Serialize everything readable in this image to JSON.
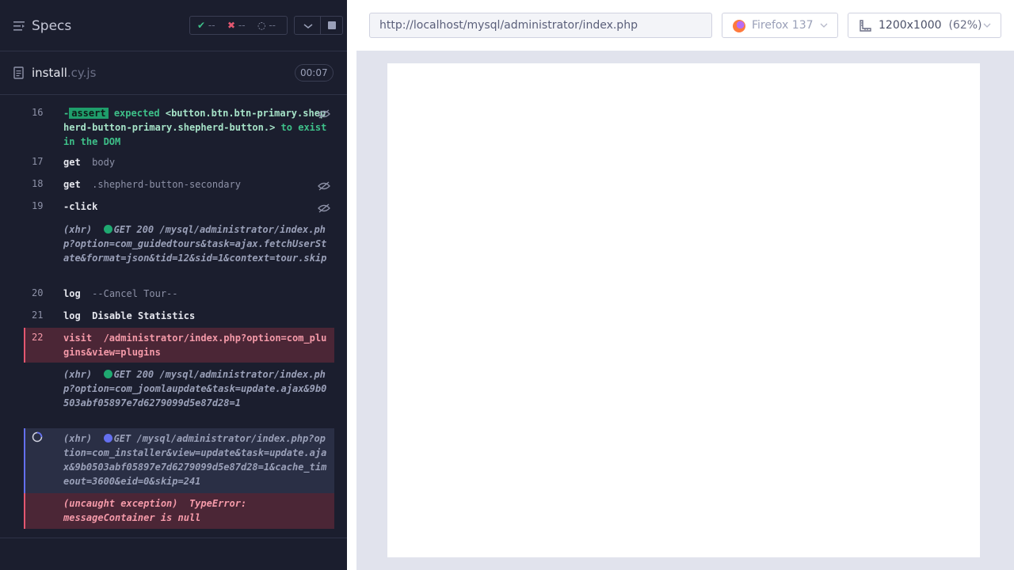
{
  "reporter": {
    "title": "Specs",
    "stats": {
      "passed": "--",
      "failed": "--",
      "pending": "--",
      "passed_sym": "✔",
      "failed_sym": "✖",
      "pending_sym": "◌"
    },
    "file": {
      "name": "install",
      "ext": ".cy.js",
      "duration": "00:07"
    },
    "commands": [
      {
        "num": "16",
        "type": "assert",
        "prefix": "-",
        "badge": "assert",
        "expected": "expected",
        "element": "<button.btn.btn-primary.shepherd-button-primary.shepherd-button.>",
        "suffix": "to exist in the DOM"
      },
      {
        "num": "17",
        "type": "cmd",
        "name": "get",
        "arg": "body"
      },
      {
        "num": "18",
        "type": "cmd",
        "name": "get",
        "arg": ".shepherd-button-secondary"
      },
      {
        "num": "19",
        "type": "cmd",
        "name": "-click",
        "arg": ""
      },
      {
        "type": "xhr",
        "label": "(xhr)",
        "text": "GET 200 /mysql/administrator/index.php?option=com_guidedtours&task=ajax.fetchUserState&format=json&tid=12&sid=1&context=tour.skip"
      },
      {
        "num": "20",
        "type": "cmd",
        "name": "log",
        "arg": "--Cancel Tour--"
      },
      {
        "num": "21",
        "type": "cmd",
        "name": "log",
        "arg": "Disable Statistics"
      },
      {
        "num": "22",
        "type": "failed",
        "name": "visit",
        "arg": "/administrator/index.php?option=com_plugins&view=plugins"
      },
      {
        "type": "xhr",
        "label": "(xhr)",
        "text": "GET 200 /mysql/administrator/index.php?option=com_joomlaupdate&task=update.ajax&9b0503abf05897e7d6279099d5e87d28=1"
      },
      {
        "type": "pending",
        "label": "(xhr)",
        "text": "GET /mysql/administrator/index.php?option=com_installer&view=update&task=update.ajax&9b0503abf05897e7d6279099d5e87d28=1&cache_timeout=3600&eid=0&skip=241"
      },
      {
        "type": "error",
        "label": "(uncaught exception)",
        "text": "TypeError: messageContainer is null"
      }
    ]
  },
  "aut": {
    "url": "http://localhost/mysql/administrator/index.php",
    "browser": "Firefox 137",
    "viewport": "1200x1000",
    "viewport_pct": "(62%)"
  },
  "icons": {
    "specs": "list-icon",
    "file": "document-icon",
    "hide": "eye-slash-icon",
    "expand": "chevron-down-icon",
    "stop": "stop-icon",
    "browser": "firefox-icon",
    "viewport": "ruler-icon"
  },
  "colors": {
    "passed": "#3ec089",
    "failed": "#e45770",
    "pending": "#6470f0",
    "panel": "#1b1e2e"
  }
}
